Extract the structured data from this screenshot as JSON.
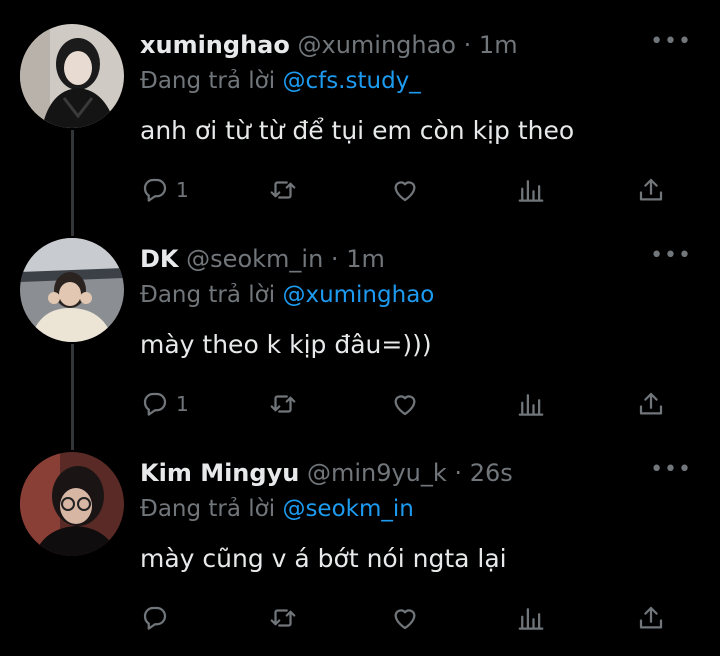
{
  "tweets": [
    {
      "name": "xuminghao",
      "handle": "@xuminghao",
      "dot": "·",
      "time": "1m",
      "reply_prefix": "Đang trả lời",
      "reply_to": "@cfs.study_",
      "text": "anh ơi từ từ để tụi em còn kịp theo",
      "reply_count": "1",
      "icons": [
        "reply-icon",
        "retweet-icon",
        "like-icon",
        "views-icon",
        "share-icon"
      ]
    },
    {
      "name": "DK",
      "handle": "@seokm_in",
      "dot": "·",
      "time": "1m",
      "reply_prefix": "Đang trả lời",
      "reply_to": "@xuminghao",
      "text": "mày theo k kịp đâu=)))",
      "reply_count": "1",
      "icons": [
        "reply-icon",
        "retweet-icon",
        "like-icon",
        "views-icon",
        "share-icon"
      ]
    },
    {
      "name": "Kim Mingyu",
      "handle": "@min9yu_k",
      "dot": "·",
      "time": "26s",
      "reply_prefix": "Đang trả lời",
      "reply_to": "@seokm_in",
      "text": "mày cũng v á bớt nói ngta lại",
      "reply_count": "",
      "icons": [
        "reply-icon",
        "retweet-icon",
        "like-icon",
        "views-icon",
        "share-icon"
      ]
    }
  ],
  "more_glyph": "•••",
  "colors": {
    "background": "#000000",
    "text": "#e7e9ea",
    "muted": "#71767b",
    "accent": "#1d9bf0",
    "thread_line": "#333639"
  }
}
